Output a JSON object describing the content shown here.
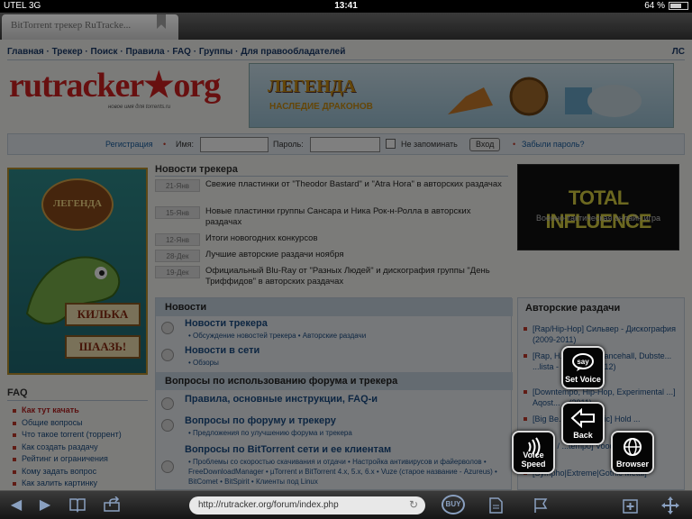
{
  "status_bar": {
    "carrier": "UTEL 3G",
    "time": "13:41",
    "battery": "64 %",
    "battery_level": 0.64
  },
  "tab": {
    "title": "BitTorrent трекер RuTracke..."
  },
  "site": {
    "nav": [
      "Главная",
      "Трекер",
      "Поиск",
      "Правила",
      "FAQ",
      "Группы",
      "Для правообладателей"
    ],
    "nav_separator": "·",
    "nav_right": "ЛС",
    "logo_text": "rutracker★org",
    "logo_sub": "новое имя для torrents.ru",
    "top_banner": {
      "title": "ЛЕГЕНДА",
      "subtitle": "НАСЛЕДИЕ ДРАКОНОВ"
    }
  },
  "login": {
    "register": "Регистрация",
    "name_label": "Имя:",
    "password_label": "Пароль:",
    "remember": "Не запоминать",
    "submit": "Вход",
    "forgot": "Забыли пароль?"
  },
  "left_banner": {
    "emblem": "ЛЕГЕНДА",
    "sign1": "КИЛЬКА",
    "sign2": "ШААЗЬ!"
  },
  "faq": {
    "title": "FAQ",
    "items": [
      "Как тут качать",
      "Общие вопросы",
      "Что такое torrent (торрент)",
      "Как создать раздачу",
      "Рейтинг и ограничения",
      "Кому задать вопрос",
      "Как залить картинку"
    ]
  },
  "news": {
    "title": "Новости трекера",
    "items": [
      {
        "date": "21-Янв",
        "text": "Свежие пластинки от \"Theodor Bastard\" и \"Atra Hora\" в авторских раздачах"
      },
      {
        "date": "15-Янв",
        "text": "Новые пластинки группы Сансара и Ника Рок-н-Ролла в авторских раздачах"
      },
      {
        "date": "12-Янв",
        "text": "Итоги новогодних конкурсов"
      },
      {
        "date": "28-Дек",
        "text": "Лучшие авторские раздачи ноября"
      },
      {
        "date": "19-Дек",
        "text": "Официальный Blu-Ray от \"Разных Людей\" и дискография группы \"День Триффидов\" в авторских раздачах"
      }
    ]
  },
  "forums": {
    "section1": "Новости",
    "section1_items": [
      {
        "name": "Новости трекера",
        "sub": "• Обсуждение новостей трекера • Авторские раздачи"
      },
      {
        "name": "Новости в сети",
        "sub": "• Обзоры"
      }
    ],
    "section2": "Вопросы по использованию форума и трекера",
    "section2_items": [
      {
        "name": "Правила, основные инструкции, FAQ-и",
        "sub": ""
      },
      {
        "name": "Вопросы по форуму и трекеру",
        "sub": "• Предложения по улучшению форума и трекера"
      },
      {
        "name": "Вопросы по BitTorrent сети и ее клиентам",
        "sub": "• Проблемы со скоростью скачивания и отдачи • Настройка антивирусов и файерволов • FreeDownloadManager • µTorrent и BitTorrent 4.x, 5.x, 6.x • Vuze (старое название - Azureus) • BitComet • BitSpirit • Клиенты под Linux"
      }
    ]
  },
  "right_banner": {
    "title": "TOTAL INFLUENCE",
    "subtitle": "Военно-тактическая онлайн игра"
  },
  "author": {
    "title": "Авторские раздачи",
    "items": [
      "[Rap/Hip-Hop] Сильвер - Дискография (2009-2011)",
      "[Rap, H... ...ggae, Dancehall, Dubste... ...lista - Brutality (2012)",
      "[Downtempo, Hip-Hop, Experimental ...] Aqost... ...(2011)",
      "[Big Be... ...Electronic] Hold ...",
      "[... ...p / ...tempo] Vood... ...(2010)",
      "[Sympho|Extreme|Gothic Metal]"
    ]
  },
  "overlay": {
    "set_voice": {
      "icon": "say",
      "label": "Set Voice"
    },
    "back": {
      "label": "Back"
    },
    "voice_speed": {
      "label": "Voice Speed"
    },
    "browser": {
      "label": "Browser"
    }
  },
  "bottom_bar": {
    "url": "http://rutracker.org/forum/index.php",
    "buy": "BUY"
  }
}
